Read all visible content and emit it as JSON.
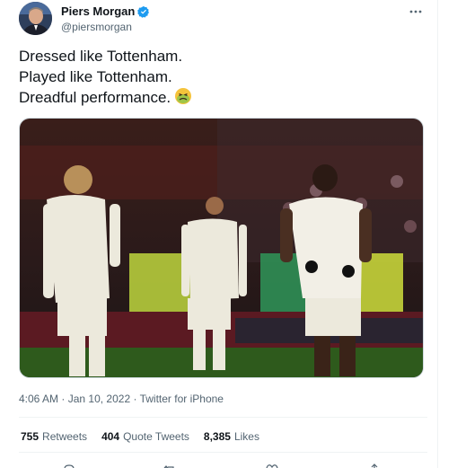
{
  "author": {
    "name": "Piers Morgan",
    "handle": "@piersmorgan"
  },
  "tweet": {
    "lines": [
      "Dressed like Tottenham.",
      "Played like Tottenham.",
      "Dreadful performance."
    ],
    "emoji": "nauseated-face-emoji"
  },
  "meta": {
    "time": "4:06 AM",
    "sep1": "·",
    "date": "Jan 10, 2022",
    "sep2": "·",
    "source": "Twitter for iPhone"
  },
  "stats": {
    "retweets_count": "755",
    "retweets_label": "Retweets",
    "quotes_count": "404",
    "quotes_label": "Quote Tweets",
    "likes_count": "8,385",
    "likes_label": "Likes"
  },
  "colors": {
    "verified": "#1d9bf0",
    "text": "#0f1419",
    "secondary": "#536471",
    "divider": "#eff3f4"
  },
  "icons": [
    "verified-badge-icon",
    "more-options-icon",
    "reply-icon",
    "retweet-icon",
    "like-icon",
    "share-icon"
  ]
}
